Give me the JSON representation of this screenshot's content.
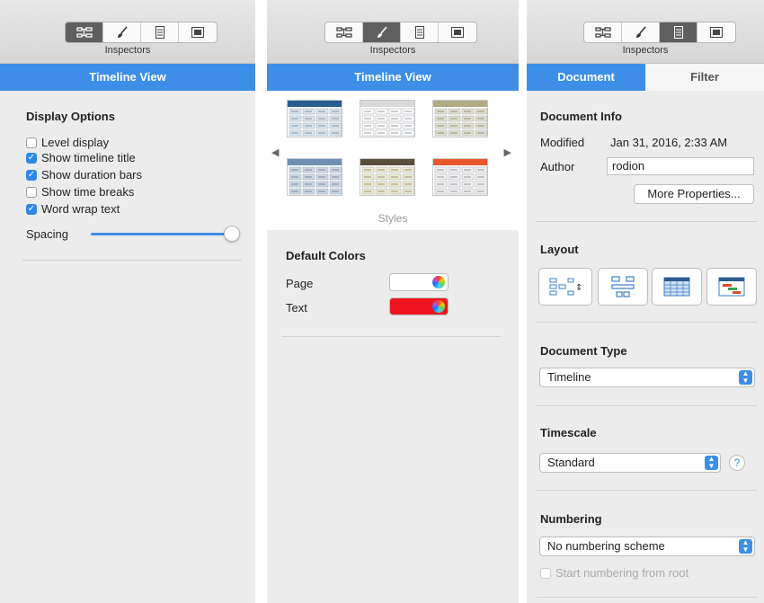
{
  "toolbar": {
    "label": "Inspectors",
    "icons": [
      "structure-icon",
      "brush-icon",
      "document-icon",
      "canvas-icon"
    ]
  },
  "panel1": {
    "header": "Timeline View",
    "display_options": {
      "title": "Display Options",
      "items": [
        {
          "label": "Level display",
          "checked": false
        },
        {
          "label": "Show timeline title",
          "checked": true
        },
        {
          "label": "Show duration bars",
          "checked": true
        },
        {
          "label": "Show time breaks",
          "checked": false
        },
        {
          "label": "Word wrap text",
          "checked": true
        }
      ]
    },
    "spacing": {
      "label": "Spacing",
      "value": 1.0
    }
  },
  "panel2": {
    "header": "Timeline View",
    "styles_label": "Styles",
    "styles": [
      {
        "name": "blue",
        "header": "#2c5b8f",
        "row": "#d8e6f2"
      },
      {
        "name": "plain",
        "header": "#d9d9d9",
        "row": "#ffffff"
      },
      {
        "name": "olive",
        "header": "#b1ab84",
        "row": "#e4e1cd"
      },
      {
        "name": "steel",
        "header": "#6f90b3",
        "row": "#c9d8e6"
      },
      {
        "name": "dark-cream",
        "header": "#5a4f3c",
        "row": "#f1ebcd"
      },
      {
        "name": "orange",
        "header": "#e8582c",
        "row": "#f2f2f2"
      }
    ],
    "default_colors": {
      "title": "Default Colors",
      "page": {
        "label": "Page",
        "color": "#ffffff"
      },
      "text": {
        "label": "Text",
        "color": "#ff0000"
      }
    }
  },
  "panel3": {
    "tabs": [
      {
        "label": "Document",
        "active": true
      },
      {
        "label": "Filter",
        "active": false
      }
    ],
    "document_info": {
      "title": "Document Info",
      "modified_label": "Modified",
      "modified_value": "Jan 31, 2016, 2:33 AM",
      "author_label": "Author",
      "author_value": "rodion",
      "more_button": "More Properties..."
    },
    "layout": {
      "title": "Layout",
      "options": [
        "org-chart-icon",
        "tree-layout-icon",
        "grid-layout-icon",
        "gantt-layout-icon"
      ]
    },
    "document_type": {
      "title": "Document Type",
      "value": "Timeline"
    },
    "timescale": {
      "title": "Timescale",
      "value": "Standard",
      "help": "?"
    },
    "numbering": {
      "title": "Numbering",
      "value": "No numbering scheme",
      "checkbox_label": "Start numbering from root",
      "checkbox_checked": false
    }
  },
  "colors": {
    "accent": "#3d8ee6",
    "panel_bg": "#ececec"
  }
}
